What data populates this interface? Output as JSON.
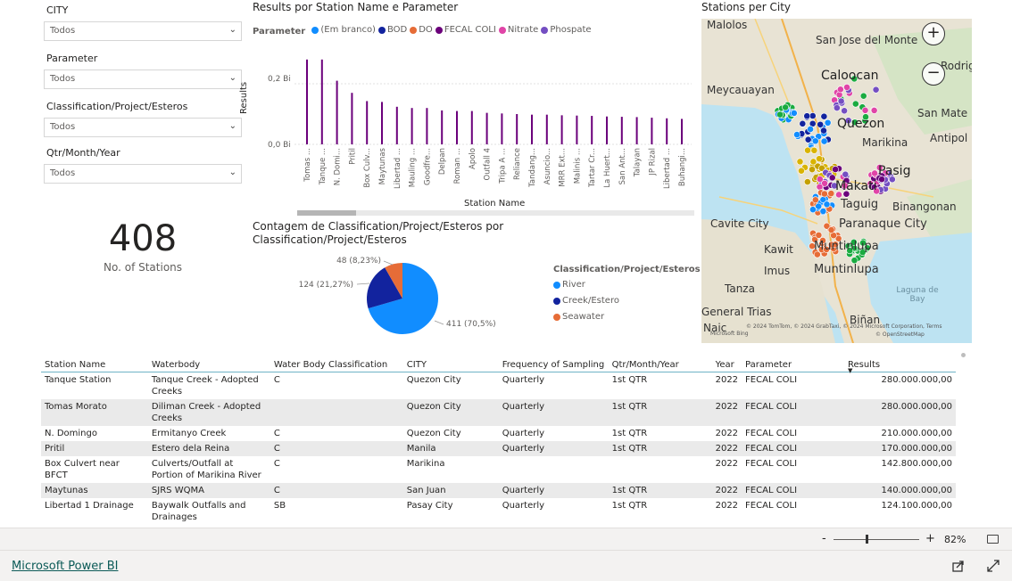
{
  "slicers": [
    {
      "label": "CITY",
      "value": "Todos"
    },
    {
      "label": "Parameter",
      "value": "Todos"
    },
    {
      "label": "Classification/Project/Esteros",
      "value": "Todos"
    },
    {
      "label": "Qtr/Month/Year",
      "value": "Todos"
    }
  ],
  "kpi": {
    "value": "408",
    "label": "No. of Stations"
  },
  "bar_chart": {
    "title": "Results por Station Name e Parameter",
    "legend_title": "Parameter",
    "legend": [
      {
        "name": "(Em branco)",
        "color": "#118dff"
      },
      {
        "name": "BOD",
        "color": "#12239e"
      },
      {
        "name": "DO",
        "color": "#e66c37"
      },
      {
        "name": "FECAL COLI",
        "color": "#6b007b"
      },
      {
        "name": "Nitrate",
        "color": "#e044a7"
      },
      {
        "name": "Phospate",
        "color": "#744ec2"
      }
    ],
    "ylabel": "Results",
    "xlabel": "Station Name",
    "y_ticks": [
      "0,2 Bi",
      "0,0 Bi"
    ]
  },
  "pie_chart": {
    "title_line1": "Contagem de Classification/Project/Esteros por",
    "title_line2": "Classification/Project/Esteros",
    "legend_title": "Classification/Project/Esteros",
    "labels": {
      "river": "411 (70,5%)",
      "creek": "124 (21,27%)",
      "seawater": "48 (8,23%)"
    }
  },
  "chart_data": [
    {
      "type": "bar",
      "title": "Results por Station Name e Parameter",
      "xlabel": "Station Name",
      "ylabel": "Results",
      "ylim": [
        0,
        300000000
      ],
      "categories": [
        "Tomas ...",
        "Tanque ...",
        "N. Domi...",
        "Pritil",
        "Box Culv...",
        "Maytunas",
        "Libertad ...",
        "Mauling ...",
        "Goodfre...",
        "Delpan",
        "Roman ...",
        "Apolo",
        "Outfall 4",
        "Tripa A ...",
        "Reliance",
        "Tandang...",
        "Asuncio...",
        "MRR Ext...",
        "Malinis ...",
        "Tartar Cr...",
        "La Huert...",
        "San Ant...",
        "Talayan",
        "JP Rizal",
        "Libertad ...",
        "Buhangi..."
      ],
      "series": [
        {
          "name": "FECAL COLI",
          "color": "#6b007b",
          "values": [
            280000000,
            280000000,
            210000000,
            170000000,
            142800000,
            140000000,
            124100000,
            120000000,
            120000000,
            112000000,
            110000000,
            110000000,
            104000000,
            102000000,
            100000000,
            98000000,
            98000000,
            96000000,
            95000000,
            94000000,
            92000000,
            91000000,
            90000000,
            88000000,
            86000000,
            84000000
          ]
        }
      ]
    },
    {
      "type": "pie",
      "title": "Contagem de Classification/Project/Esteros por Classification/Project/Esteros",
      "categories": [
        "River",
        "Creek/Estero",
        "Seawater"
      ],
      "values": [
        411,
        124,
        48
      ],
      "colors": [
        "#118dff",
        "#12239e",
        "#e66c37"
      ]
    }
  ],
  "map": {
    "title": "Stations per City",
    "places": [
      {
        "name": "Malolos"
      },
      {
        "name": "San Jose del Monte"
      },
      {
        "name": "Rodrigue"
      },
      {
        "name": "Meycauayan"
      },
      {
        "name": "Caloocan"
      },
      {
        "name": "Quezon"
      },
      {
        "name": "San Mate"
      },
      {
        "name": "Antipol"
      },
      {
        "name": "Marikina"
      },
      {
        "name": "Pasig"
      },
      {
        "name": "Makati"
      },
      {
        "name": "Cavite City"
      },
      {
        "name": "Taguig"
      },
      {
        "name": "Binangonan"
      },
      {
        "name": "Paranaque City"
      },
      {
        "name": "Kawit"
      },
      {
        "name": "Muntinlupa"
      },
      {
        "name": "Imus"
      },
      {
        "name": "Muntinlupa"
      },
      {
        "name": "Tanza"
      },
      {
        "name": "Laguna de Bay"
      },
      {
        "name": "General Trias"
      },
      {
        "name": "Biñan"
      },
      {
        "name": "Naic"
      }
    ],
    "attribution": "© 2024 TomTom, © 2024 GrabTaxi, © 2024 Microsoft Corporation, Terms",
    "attribution2": "© OpenStreetMap",
    "ms_logo": "Microsoft Bing",
    "zoom_in": "+",
    "zoom_out": "−"
  },
  "table": {
    "headers": [
      "Station Name",
      "Waterbody",
      "Water Body Classification",
      "CITY",
      "Frequency of Sampling",
      "Qtr/Month/Year",
      "Year",
      "Parameter",
      "Results"
    ],
    "rows": [
      [
        "Tanque Station",
        "Tanque Creek - Adopted Creeks",
        "C",
        "Quezon City",
        "Quarterly",
        "1st QTR",
        "2022",
        "FECAL COLI",
        "280.000.000,00"
      ],
      [
        "Tomas Morato",
        "Diliman Creek - Adopted Creeks",
        "",
        "Quezon City",
        "Quarterly",
        "1st QTR",
        "2022",
        "FECAL COLI",
        "280.000.000,00"
      ],
      [
        "N. Domingo",
        "Ermitanyo Creek",
        "C",
        "Quezon City",
        "Quarterly",
        "1st QTR",
        "2022",
        "FECAL COLI",
        "210.000.000,00"
      ],
      [
        "Pritil",
        "Estero dela Reina",
        "C",
        "Manila",
        "Quarterly",
        "1st QTR",
        "2022",
        "FECAL COLI",
        "170.000.000,00"
      ],
      [
        "Box Culvert near BFCT",
        "Culverts/Outfall at Portion of Marikina River",
        "C",
        "Marikina",
        "",
        "",
        "2022",
        "FECAL COLI",
        "142.800.000,00"
      ],
      [
        "Maytunas",
        "SJRS WQMA",
        "C",
        "San Juan",
        "Quarterly",
        "1st QTR",
        "2022",
        "FECAL COLI",
        "140.000.000,00"
      ],
      [
        "Libertad 1 Drainage",
        "Baywalk Outfalls and Drainages",
        "SB",
        "Pasay City",
        "Quarterly",
        "1st QTR",
        "2022",
        "FECAL COLI",
        "124.100.000,00"
      ]
    ]
  },
  "footer": {
    "brand": "Microsoft Power BI",
    "zoom_minus": "-",
    "zoom_plus": "+",
    "zoom_level": "82%"
  }
}
